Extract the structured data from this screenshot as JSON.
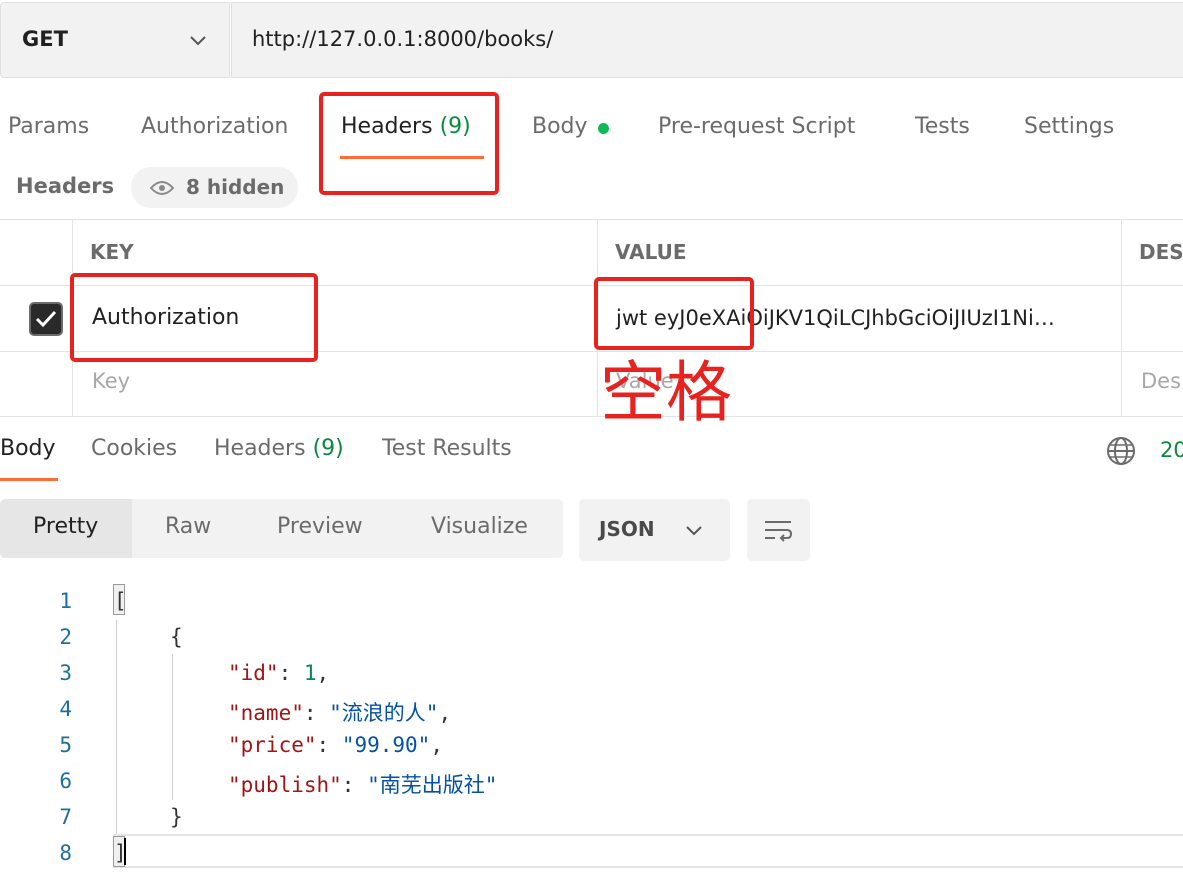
{
  "request": {
    "method": "GET",
    "url": "http://127.0.0.1:8000/books/"
  },
  "request_tabs": [
    {
      "label": "Params"
    },
    {
      "label": "Authorization"
    },
    {
      "label": "Headers",
      "count": "(9)",
      "active": true
    },
    {
      "label": "Body",
      "indicator": "green-dot"
    },
    {
      "label": "Pre-request Script"
    },
    {
      "label": "Tests"
    },
    {
      "label": "Settings"
    }
  ],
  "headers_section": {
    "title": "Headers",
    "hidden_label": "8 hidden",
    "columns": [
      "KEY",
      "VALUE",
      "DES"
    ],
    "rows": [
      {
        "checked": true,
        "key": "Authorization",
        "value": "jwt eyJ0eXAiOiJKV1QiLCJhbGciOiJIUzI1Ni…",
        "description": ""
      }
    ],
    "new_row_placeholders": {
      "key": "Key",
      "value": "Value",
      "description": "Des"
    }
  },
  "annotation": {
    "text": "空格",
    "color": "#e8231f"
  },
  "response_tabs": [
    {
      "label": "Body",
      "active": true
    },
    {
      "label": "Cookies"
    },
    {
      "label": "Headers",
      "count": "(9)"
    },
    {
      "label": "Test Results"
    }
  ],
  "response_status": "20",
  "view_modes": [
    {
      "label": "Pretty",
      "active": true
    },
    {
      "label": "Raw"
    },
    {
      "label": "Preview"
    },
    {
      "label": "Visualize"
    }
  ],
  "format": "JSON",
  "icons": {
    "method_dropdown": "chevron-down-icon",
    "hidden_headers": "eye-icon",
    "enabled": "checkmark-icon",
    "network": "globe-icon",
    "format_dropdown": "chevron-down-icon",
    "wrap": "text-wrap-icon"
  },
  "colors": {
    "accent": "#ff6c37",
    "status_green": "#0a8a3c",
    "annotation_red": "#e8231f"
  },
  "response_body": {
    "line_numbers": [
      "1",
      "2",
      "3",
      "4",
      "5",
      "6",
      "7",
      "8"
    ],
    "lines": [
      {
        "open": "["
      },
      {
        "open": "{"
      },
      {
        "key": "\"id\"",
        "sep": ": ",
        "num": "1",
        "end": ","
      },
      {
        "key": "\"name\"",
        "sep": ": ",
        "str": "\"流浪的人\"",
        "end": ","
      },
      {
        "key": "\"price\"",
        "sep": ": ",
        "str": "\"99.90\"",
        "end": ","
      },
      {
        "key": "\"publish\"",
        "sep": ": ",
        "str": "\"南芜出版社\"",
        "end": ""
      },
      {
        "close": "}"
      },
      {
        "close": "]"
      }
    ]
  }
}
